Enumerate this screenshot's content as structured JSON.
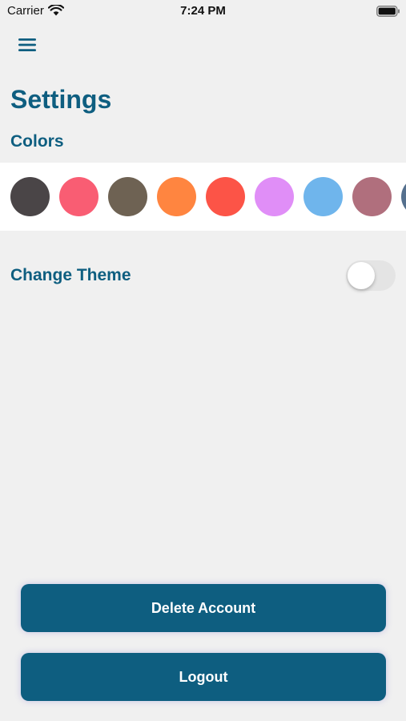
{
  "status_bar": {
    "carrier": "Carrier",
    "time": "7:24 PM",
    "wifi_icon": "wifi-icon",
    "battery_icon": "battery-icon"
  },
  "header": {
    "menu_icon": "hamburger-menu-icon",
    "title": "Settings"
  },
  "colors": {
    "label": "Colors",
    "swatches": [
      "#4a4547",
      "#f95d73",
      "#6e6253",
      "#ff8540",
      "#fc5447",
      "#e08ef7",
      "#6fb5ec",
      "#b06f7d",
      "#55708e"
    ]
  },
  "theme": {
    "label": "Change Theme",
    "enabled": false
  },
  "actions": {
    "delete_label": "Delete Account",
    "logout_label": "Logout"
  },
  "palette": {
    "accent": "#0e5e80",
    "background": "#f0f0f0",
    "strip": "#ffffff"
  }
}
